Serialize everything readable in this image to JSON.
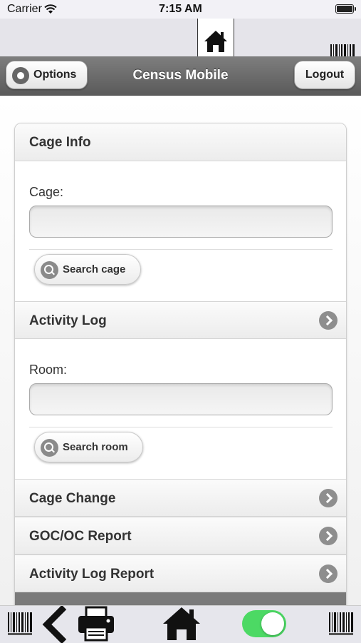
{
  "status_bar": {
    "carrier": "Carrier",
    "time": "7:15 AM"
  },
  "header": {
    "title": "Census Mobile",
    "options_label": "Options",
    "logout_label": "Logout"
  },
  "card": {
    "cage_info": {
      "title": "Cage Info",
      "cage_label": "Cage:",
      "cage_value": "",
      "search_label": "Search cage"
    },
    "activity_log": {
      "title": "Activity Log"
    },
    "room": {
      "label": "Room:",
      "value": "",
      "search_label": "Search room"
    },
    "links": [
      {
        "label": "Cage Change"
      },
      {
        "label": "GOC/OC Report"
      },
      {
        "label": "Activity Log Report"
      }
    ]
  },
  "toggle": {
    "state": "on"
  },
  "colors": {
    "toggle_on": "#4cd964",
    "header_bg": "#6b6b6b"
  }
}
